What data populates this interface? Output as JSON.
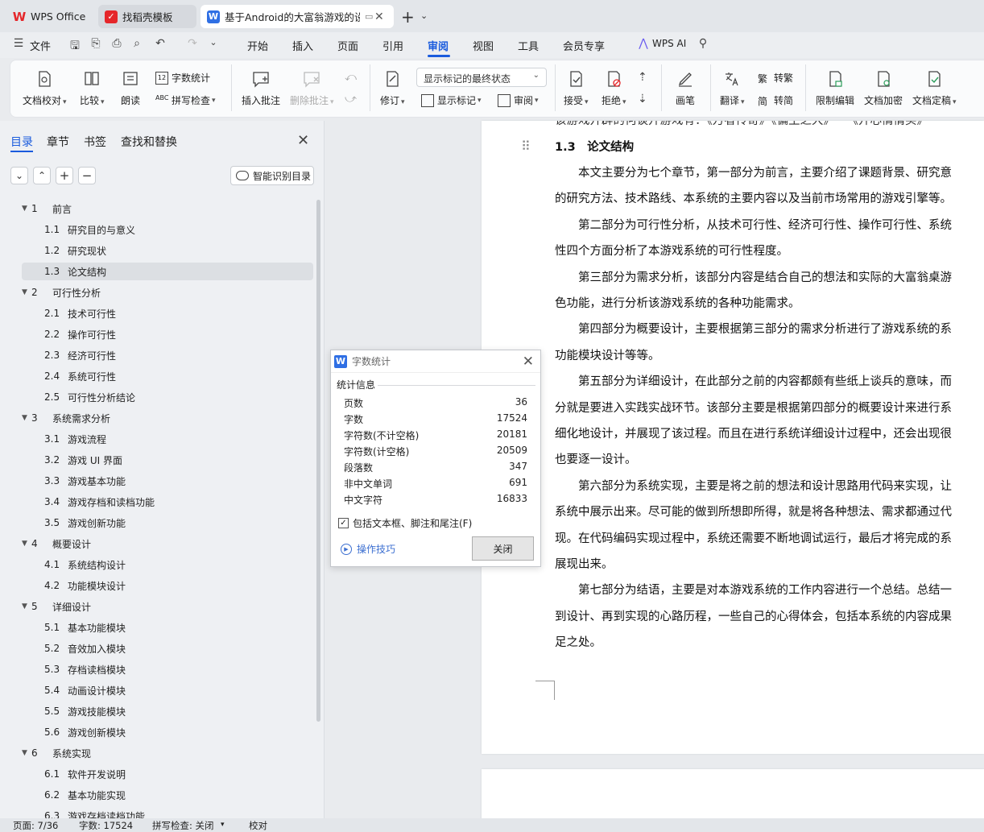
{
  "tabs": {
    "wps_office": "WPS Office",
    "template": "找稻壳模板",
    "document": "基于Android的大富翁游戏的设"
  },
  "menu": {
    "file": "文件",
    "items": [
      "开始",
      "插入",
      "页面",
      "引用",
      "审阅",
      "视图",
      "工具",
      "会员专享"
    ],
    "wps_ai": "WPS AI"
  },
  "ribbon": {
    "doc_check": "文档校对",
    "compare": "比较",
    "read_aloud": "朗读",
    "word_count": "字数统计",
    "spell_check": "拼写检查",
    "insert_comment": "插入批注",
    "delete_comment": "删除批注",
    "track_changes": "修订",
    "markup_state": "显示标记的最终状态",
    "show_markup": "显示标记",
    "review_pane": "审阅",
    "accept": "接受",
    "reject": "拒绝",
    "pen": "画笔",
    "translate": "翻译",
    "to_traditional": "转繁",
    "to_simplified": "转简",
    "trad_char": "繁",
    "simp_char": "简",
    "restrict_edit": "限制编辑",
    "doc_encrypt": "文档加密",
    "doc_finalize": "文档定稿"
  },
  "nav": {
    "tabs": [
      "目录",
      "章节",
      "书签",
      "查找和替换"
    ],
    "smart_toc": "智能识别目录",
    "toc": [
      {
        "num": "1",
        "title": "前言",
        "level": 1
      },
      {
        "num": "1.1",
        "title": "研究目的与意义",
        "level": 2
      },
      {
        "num": "1.2",
        "title": "研究现状",
        "level": 2
      },
      {
        "num": "1.3",
        "title": "论文结构",
        "level": 2,
        "active": true
      },
      {
        "num": "2",
        "title": "可行性分析",
        "level": 1
      },
      {
        "num": "2.1",
        "title": "技术可行性",
        "level": 2
      },
      {
        "num": "2.2",
        "title": "操作可行性",
        "level": 2
      },
      {
        "num": "2.3",
        "title": "经济可行性",
        "level": 2
      },
      {
        "num": "2.4",
        "title": "系统可行性",
        "level": 2
      },
      {
        "num": "2.5",
        "title": "可行性分析结论",
        "level": 2
      },
      {
        "num": "3",
        "title": "系统需求分析",
        "level": 1
      },
      {
        "num": "3.1",
        "title": "游戏流程",
        "level": 2
      },
      {
        "num": "3.2",
        "title": "游戏 UI 界面",
        "level": 2
      },
      {
        "num": "3.3",
        "title": "游戏基本功能",
        "level": 2
      },
      {
        "num": "3.4",
        "title": "游戏存档和读档功能",
        "level": 2
      },
      {
        "num": "3.5",
        "title": "游戏创新功能",
        "level": 2
      },
      {
        "num": "4",
        "title": "概要设计",
        "level": 1
      },
      {
        "num": "4.1",
        "title": "系统结构设计",
        "level": 2
      },
      {
        "num": "4.2",
        "title": "功能模块设计",
        "level": 2
      },
      {
        "num": "5",
        "title": "详细设计",
        "level": 1
      },
      {
        "num": "5.1",
        "title": "基本功能模块",
        "level": 2
      },
      {
        "num": "5.2",
        "title": "音效加入模块",
        "level": 2
      },
      {
        "num": "5.3",
        "title": "存档读档模块",
        "level": 2
      },
      {
        "num": "5.4",
        "title": "动画设计模块",
        "level": 2
      },
      {
        "num": "5.5",
        "title": "游戏技能模块",
        "level": 2
      },
      {
        "num": "5.6",
        "title": "游戏创新模块",
        "level": 2
      },
      {
        "num": "6",
        "title": "系统实现",
        "level": 1
      },
      {
        "num": "6.1",
        "title": "软件开发说明",
        "level": 2
      },
      {
        "num": "6.2",
        "title": "基本功能实现",
        "level": 2
      },
      {
        "num": "6.3",
        "title": "游戏存档读档功能",
        "level": 2
      }
    ]
  },
  "document": {
    "top_partial": "该游戏开辟的何谈开游戏有：《万者传奇》《偏生之大》一《开心情情买》",
    "heading": "1.3　论文结构",
    "lines": [
      "　　本文主要分为七个章节，第一部分为前言，主要介绍了课题背景、研究意",
      "的研究方法、技术路线、本系统的主要内容以及当前市场常用的游戏引擎等。",
      "　　第二部分为可行性分析，从技术可行性、经济可行性、操作可行性、系统",
      "性四个方面分析了本游戏系统的可行性程度。",
      "　　第三部分为需求分析，该部分内容是结合自己的想法和实际的大富翁桌游",
      "色功能，进行分析该游戏系统的各种功能需求。",
      "　　第四部分为概要设计，主要根据第三部分的需求分析进行了游戏系统的系",
      "功能模块设计等等。",
      "　　第五部分为详细设计，在此部分之前的内容都颇有些纸上谈兵的意味，而",
      "分就是要进入实践实战环节。该部分主要是根据第四部分的概要设计来进行系",
      "细化地设计，并展现了该过程。而且在进行系统详细设计过程中，还会出现很",
      "也要逐一设计。",
      "　　第六部分为系统实现，主要是将之前的想法和设计思路用代码来实现，让",
      "系统中展示出来。尽可能的做到所想即所得，就是将各种想法、需求都通过代",
      "现。在代码编码实现过程中，系统还需要不断地调试运行，最后才将完成的系",
      "展现出来。",
      "　　第七部分为结语，主要是对本游戏系统的工作内容进行一个总结。总结一",
      "到设计、再到实现的心路历程，一些自己的心得体会，包括本系统的内容成果",
      "足之处。"
    ]
  },
  "dialog": {
    "title": "字数统计",
    "section": "统计信息",
    "stats": [
      {
        "label": "页数",
        "value": "36"
      },
      {
        "label": "字数",
        "value": "17524"
      },
      {
        "label": "字符数(不计空格)",
        "value": "20181"
      },
      {
        "label": "字符数(计空格)",
        "value": "20509"
      },
      {
        "label": "段落数",
        "value": "347"
      },
      {
        "label": "非中文单词",
        "value": "691"
      },
      {
        "label": "中文字符",
        "value": "16833"
      }
    ],
    "include_label": "包括文本框、脚注和尾注(F)",
    "include_checked": true,
    "tips": "操作技巧",
    "close": "关闭"
  },
  "status": {
    "page": "页面: 7/36",
    "words": "字数: 17524",
    "spell": "拼写检查: 关闭",
    "proof": "校对"
  },
  "colors": {
    "accent": "#1a5bdd",
    "wps_red": "#e5262a",
    "doc_blue": "#2f6fe4"
  }
}
